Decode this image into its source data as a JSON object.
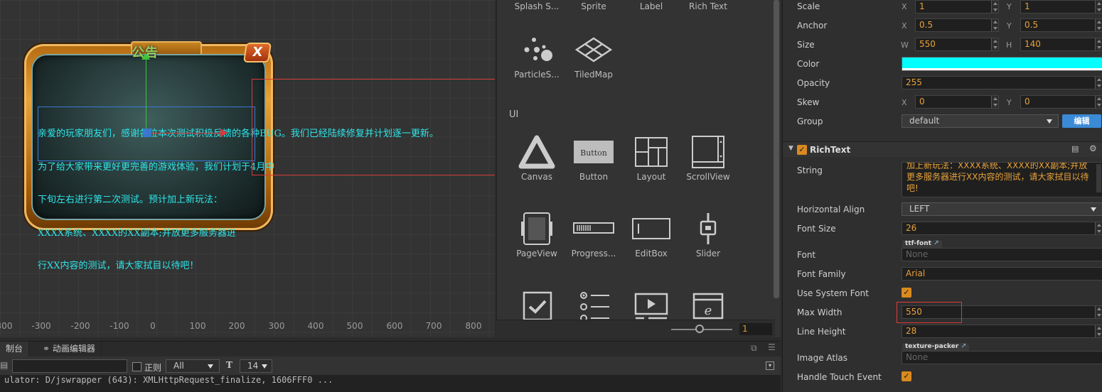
{
  "scene": {
    "frame_title": "公告",
    "close_glyph": "X",
    "richtext_lines": [
      "亲爱的玩家朋友们，感谢各位本次测试积极反馈的各种BUG。我们已经陆续修复并计划逐一更新。",
      "为了给大家带来更好更完善的游戏体验，我们计划于4月中",
      "下旬左右进行第二次测试。预计加上新玩法：",
      "XXXX系统、XXXX的XX副本;并放更多服务器进",
      "行XX内容的测试，请大家拭目以待吧！"
    ],
    "ruler_ticks": [
      "300",
      "-300",
      "-200",
      "-100",
      "0",
      "100",
      "200",
      "300",
      "400",
      "500",
      "600",
      "700",
      "800"
    ]
  },
  "library": {
    "items_top": [
      {
        "label": "Splash S...",
        "icon": "splash-icon"
      },
      {
        "label": "Sprite",
        "icon": "sprite-icon"
      },
      {
        "label": "Label",
        "icon": "label-icon"
      },
      {
        "label": "Rich Text",
        "icon": "richtext-icon"
      }
    ],
    "items_row2": [
      {
        "label": "ParticleS...",
        "icon": "particle-icon"
      },
      {
        "label": "TiledMap",
        "icon": "tiledmap-icon"
      }
    ],
    "section_ui": "UI",
    "items_ui1": [
      {
        "label": "Canvas",
        "icon": "canvas-icon"
      },
      {
        "label": "Button",
        "icon": "button-icon",
        "text": "Button"
      },
      {
        "label": "Layout",
        "icon": "layout-icon"
      },
      {
        "label": "ScrollView",
        "icon": "scrollview-icon"
      }
    ],
    "items_ui2": [
      {
        "label": "PageView",
        "icon": "pageview-icon"
      },
      {
        "label": "Progress...",
        "icon": "progressbar-icon"
      },
      {
        "label": "EditBox",
        "icon": "editbox-icon"
      },
      {
        "label": "Slider",
        "icon": "slider-icon"
      }
    ],
    "zoom_value": "1"
  },
  "console": {
    "tab_console": "制台",
    "tab_anim": "动画编辑器",
    "regex_label": "正则",
    "filter_value": "All",
    "font_size_value": "14",
    "log_line": "ulator: D/jswrapper (643): XMLHttpRequest_finalize, 1606FFF0 ..."
  },
  "inspector": {
    "scale": {
      "label": "Scale",
      "x": "1",
      "y": "1"
    },
    "anchor": {
      "label": "Anchor",
      "x": "0.5",
      "y": "0.5"
    },
    "size": {
      "label": "Size",
      "w": "550",
      "h": "140"
    },
    "color": {
      "label": "Color",
      "value": "#00FFFF"
    },
    "opacity": {
      "label": "Opacity",
      "value": "255"
    },
    "skew": {
      "label": "Skew",
      "x": "0",
      "y": "0"
    },
    "group": {
      "label": "Group",
      "value": "default",
      "edit_button": "编辑"
    },
    "component_title": "RichText",
    "string": {
      "label": "String",
      "value": "加上新玩法：XXXX系统、XXXX的XX副本;并放更多服务器进行XX内容的测试，请大家拭目以待吧!"
    },
    "halign": {
      "label": "Horizontal Align",
      "value": "LEFT"
    },
    "font_size": {
      "label": "Font Size",
      "value": "26"
    },
    "font": {
      "label": "Font",
      "tag": "ttf-font",
      "value": "None"
    },
    "font_family": {
      "label": "Font Family",
      "value": "Arial"
    },
    "use_system_font": {
      "label": "Use System Font",
      "checked": true
    },
    "max_width": {
      "label": "Max Width",
      "value": "550"
    },
    "line_height": {
      "label": "Line Height",
      "value": "28"
    },
    "image_atlas": {
      "label": "Image Atlas",
      "tag": "texture-packer",
      "value": "None"
    },
    "handle_touch": {
      "label": "Handle Touch Event",
      "checked": true
    },
    "axis_x": "X",
    "axis_y": "Y",
    "axis_w": "W",
    "axis_h": "H",
    "accent_color": "#E8A23A"
  }
}
